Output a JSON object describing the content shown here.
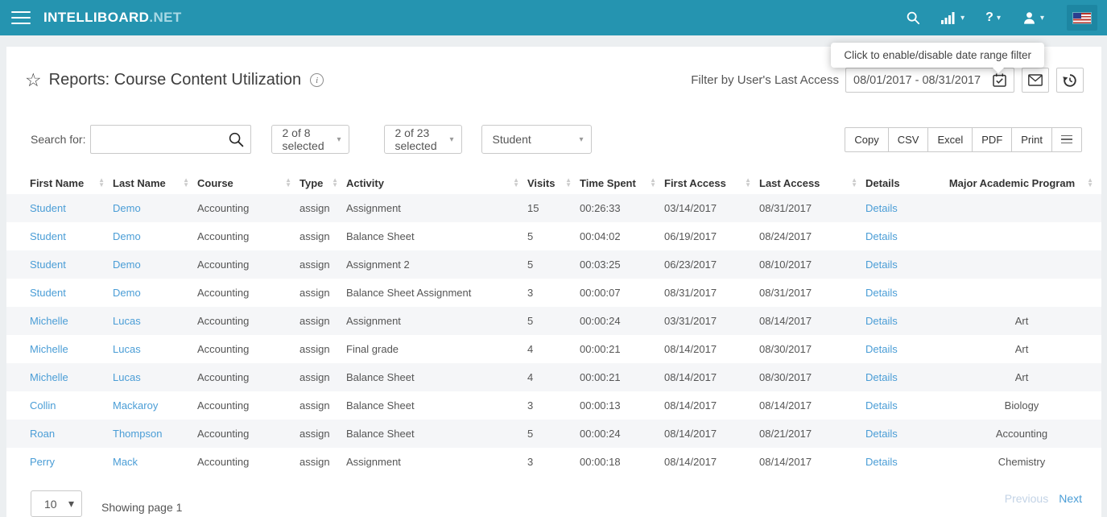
{
  "navbar": {
    "brand_primary": "INTELLIBOARD",
    "brand_suffix": ".NET",
    "icons": [
      "search-icon",
      "stats-icon",
      "help-icon",
      "user-icon",
      "us-flag"
    ]
  },
  "tooltip": {
    "text": "Click to enable/disable date range filter"
  },
  "header": {
    "title": "Reports: Course Content Utilization",
    "filter_label": "Filter by User's Last Access",
    "date_range": "08/01/2017 - 08/31/2017"
  },
  "toolbar": {
    "search_label": "Search for:",
    "search_value": "",
    "filters": [
      "2 of 8 selected",
      "2 of 23 selected",
      "Student"
    ],
    "export_buttons": [
      "Copy",
      "CSV",
      "Excel",
      "PDF",
      "Print"
    ]
  },
  "table": {
    "columns": [
      {
        "key": "first_name",
        "label": "First Name",
        "sortable": true,
        "link": true
      },
      {
        "key": "last_name",
        "label": "Last Name",
        "sortable": true,
        "link": true
      },
      {
        "key": "course",
        "label": "Course",
        "sortable": true,
        "link": false
      },
      {
        "key": "type",
        "label": "Type",
        "sortable": true,
        "link": false
      },
      {
        "key": "activity",
        "label": "Activity",
        "sortable": true,
        "link": false
      },
      {
        "key": "visits",
        "label": "Visits",
        "sortable": true,
        "link": false
      },
      {
        "key": "time_spent",
        "label": "Time Spent",
        "sortable": true,
        "link": false
      },
      {
        "key": "first_access",
        "label": "First Access",
        "sortable": true,
        "link": false
      },
      {
        "key": "last_access",
        "label": "Last Access",
        "sortable": true,
        "link": false
      },
      {
        "key": "details",
        "label": "Details",
        "sortable": false,
        "link": true
      },
      {
        "key": "major",
        "label": "Major Academic Program",
        "sortable": true,
        "link": false,
        "align": "center"
      }
    ],
    "rows": [
      {
        "first_name": "Student",
        "last_name": "Demo",
        "course": "Accounting",
        "type": "assign",
        "activity": "Assignment",
        "visits": "15",
        "time_spent": "00:26:33",
        "first_access": "03/14/2017",
        "last_access": "08/31/2017",
        "details": "Details",
        "major": ""
      },
      {
        "first_name": "Student",
        "last_name": "Demo",
        "course": "Accounting",
        "type": "assign",
        "activity": "Balance Sheet",
        "visits": "5",
        "time_spent": "00:04:02",
        "first_access": "06/19/2017",
        "last_access": "08/24/2017",
        "details": "Details",
        "major": ""
      },
      {
        "first_name": "Student",
        "last_name": "Demo",
        "course": "Accounting",
        "type": "assign",
        "activity": "Assignment 2",
        "visits": "5",
        "time_spent": "00:03:25",
        "first_access": "06/23/2017",
        "last_access": "08/10/2017",
        "details": "Details",
        "major": ""
      },
      {
        "first_name": "Student",
        "last_name": "Demo",
        "course": "Accounting",
        "type": "assign",
        "activity": "Balance Sheet Assignment",
        "visits": "3",
        "time_spent": "00:00:07",
        "first_access": "08/31/2017",
        "last_access": "08/31/2017",
        "details": "Details",
        "major": ""
      },
      {
        "first_name": "Michelle",
        "last_name": "Lucas",
        "course": "Accounting",
        "type": "assign",
        "activity": "Assignment",
        "visits": "5",
        "time_spent": "00:00:24",
        "first_access": "03/31/2017",
        "last_access": "08/14/2017",
        "details": "Details",
        "major": "Art"
      },
      {
        "first_name": "Michelle",
        "last_name": "Lucas",
        "course": "Accounting",
        "type": "assign",
        "activity": "Final grade",
        "visits": "4",
        "time_spent": "00:00:21",
        "first_access": "08/14/2017",
        "last_access": "08/30/2017",
        "details": "Details",
        "major": "Art"
      },
      {
        "first_name": "Michelle",
        "last_name": "Lucas",
        "course": "Accounting",
        "type": "assign",
        "activity": "Balance Sheet",
        "visits": "4",
        "time_spent": "00:00:21",
        "first_access": "08/14/2017",
        "last_access": "08/30/2017",
        "details": "Details",
        "major": "Art"
      },
      {
        "first_name": "Collin",
        "last_name": "Mackaroy",
        "course": "Accounting",
        "type": "assign",
        "activity": "Balance Sheet",
        "visits": "3",
        "time_spent": "00:00:13",
        "first_access": "08/14/2017",
        "last_access": "08/14/2017",
        "details": "Details",
        "major": "Biology"
      },
      {
        "first_name": "Roan",
        "last_name": "Thompson",
        "course": "Accounting",
        "type": "assign",
        "activity": "Balance Sheet",
        "visits": "5",
        "time_spent": "00:00:24",
        "first_access": "08/14/2017",
        "last_access": "08/21/2017",
        "details": "Details",
        "major": "Accounting"
      },
      {
        "first_name": "Perry",
        "last_name": "Mack",
        "course": "Accounting",
        "type": "assign",
        "activity": "Assignment",
        "visits": "3",
        "time_spent": "00:00:18",
        "first_access": "08/14/2017",
        "last_access": "08/14/2017",
        "details": "Details",
        "major": "Chemistry"
      }
    ]
  },
  "footer": {
    "page_size": "10",
    "showing": "Showing page 1",
    "previous_label": "Previous",
    "next_label": "Next"
  },
  "colors": {
    "navbar": "#2594b0",
    "link": "#4a9dd6",
    "stripe": "#f5f6f8",
    "disabled_link": "#c3d3e6"
  }
}
